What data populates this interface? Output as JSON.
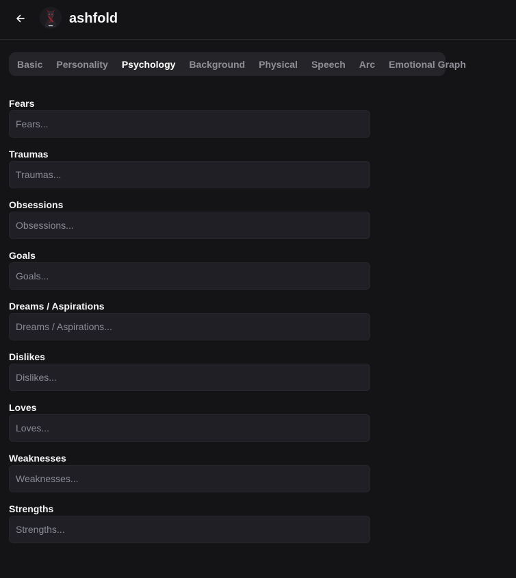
{
  "header": {
    "title": "ashfold",
    "back_icon": "arrow-left-icon",
    "avatar_icon": "character-avatar"
  },
  "tabs": [
    {
      "label": "Basic",
      "active": false
    },
    {
      "label": "Personality",
      "active": false
    },
    {
      "label": "Psychology",
      "active": true
    },
    {
      "label": "Background",
      "active": false
    },
    {
      "label": "Physical",
      "active": false
    },
    {
      "label": "Speech",
      "active": false
    },
    {
      "label": "Arc",
      "active": false
    },
    {
      "label": "Emotional Graph",
      "active": false
    }
  ],
  "fields": [
    {
      "label": "Fears",
      "placeholder": "Fears...",
      "value": ""
    },
    {
      "label": "Traumas",
      "placeholder": "Traumas...",
      "value": ""
    },
    {
      "label": "Obsessions",
      "placeholder": "Obsessions...",
      "value": ""
    },
    {
      "label": "Goals",
      "placeholder": "Goals...",
      "value": ""
    },
    {
      "label": "Dreams / Aspirations",
      "placeholder": "Dreams / Aspirations...",
      "value": ""
    },
    {
      "label": "Dislikes",
      "placeholder": "Dislikes...",
      "value": ""
    },
    {
      "label": "Loves",
      "placeholder": "Loves...",
      "value": ""
    },
    {
      "label": "Weaknesses",
      "placeholder": "Weaknesses...",
      "value": ""
    },
    {
      "label": "Strengths",
      "placeholder": "Strengths...",
      "value": ""
    }
  ],
  "colors": {
    "background": "#141416",
    "tab_bar": "#252529",
    "input_bg": "#1f1f25",
    "tab_inactive": "#8e8e96",
    "tab_active": "#ffffff"
  }
}
